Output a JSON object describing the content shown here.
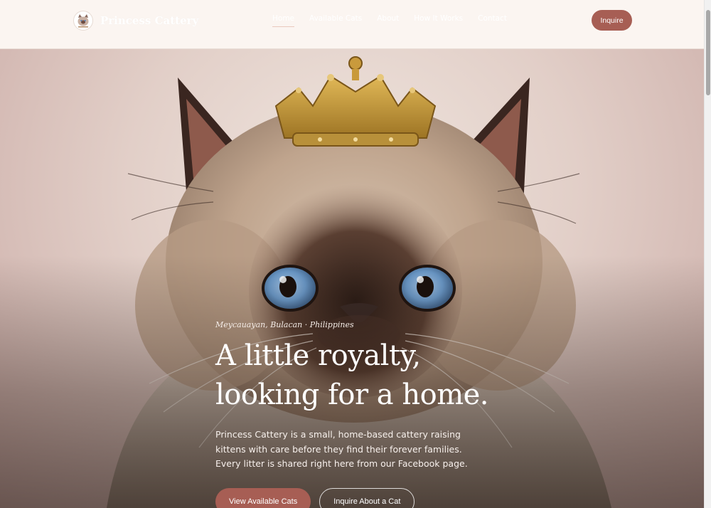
{
  "header": {
    "brand_name": "Princess Cattery",
    "logo_icon": "cat-crest-logo",
    "nav": [
      {
        "label": "Home",
        "active": true
      },
      {
        "label": "Available Cats",
        "active": false
      },
      {
        "label": "About",
        "active": false
      },
      {
        "label": "How It Works",
        "active": false
      },
      {
        "label": "Contact",
        "active": false
      }
    ],
    "cta_label": "Inquire"
  },
  "hero": {
    "image_icon": "crowned-cat-portrait",
    "eyebrow": "Meycauayan, Bulacan · Philippines",
    "headline_line1": "A little royalty,",
    "headline_line2": "looking for a home.",
    "copy": "Princess Cattery is a small, home-based cattery raising kittens with care before they find their forever families. Every litter is shared right here from our Facebook page.",
    "primary_cta": "View Available Cats",
    "secondary_cta": "Inquire About a Cat"
  },
  "colors": {
    "accent": "#a75e54",
    "header_bg": "#fbf5f1",
    "hero_bg": "#e2cfc8"
  }
}
